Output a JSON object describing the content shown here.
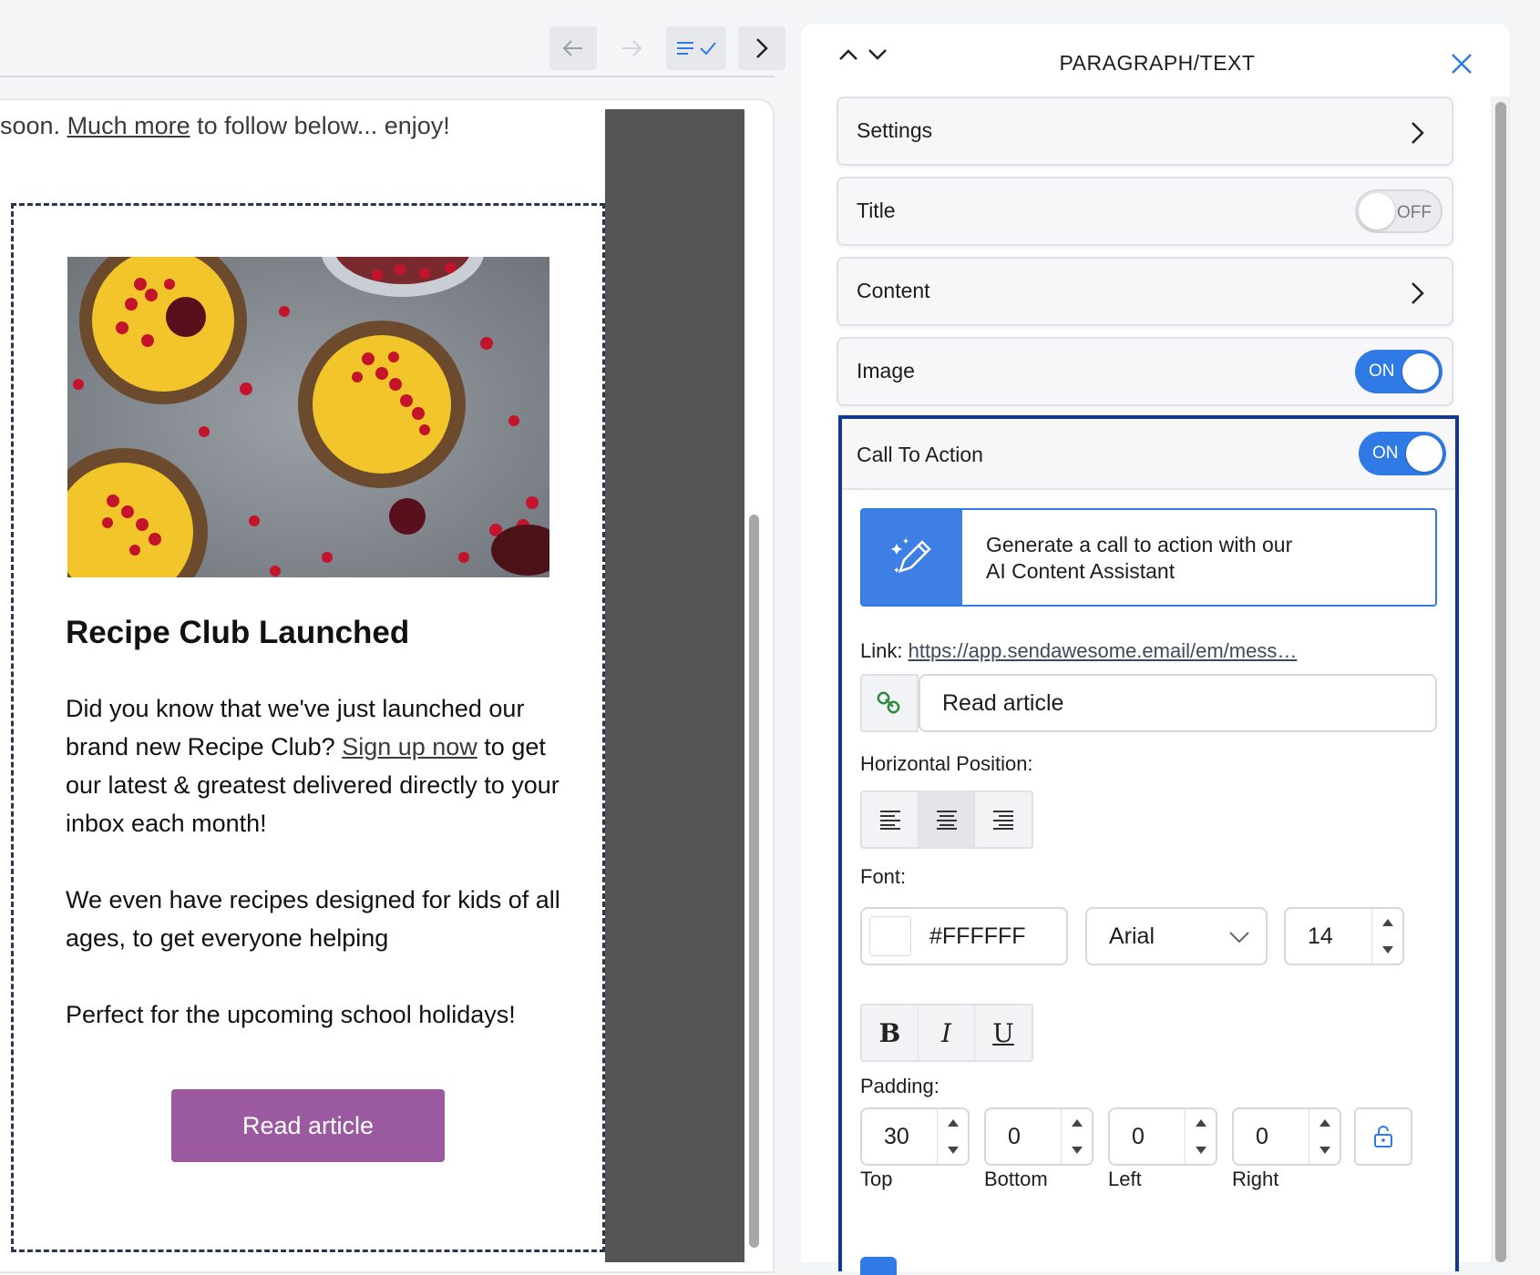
{
  "toolbar": {
    "back_icon": "arrow-left-icon",
    "forward_icon": "arrow-right-icon",
    "spellcheck_icon": "spellcheck-icon",
    "next_icon": "chevron-right-icon"
  },
  "email": {
    "intro_prefix": "soon. ",
    "intro_link": "Much more",
    "intro_suffix": " to follow below... enjoy!",
    "block_title": "Recipe Club Launched",
    "para1_before": "Did you know that we've just launched our brand new Recipe Club? ",
    "para1_link": "Sign up now",
    "para1_after": " to get our latest & greatest delivered directly to your inbox each month!",
    "para2": "We even have recipes designed for kids of all ages, to get everyone helping",
    "para3": "Perfect for the upcoming school holidays!",
    "button_label": "Read article",
    "button_color": "#9b59a0"
  },
  "panel": {
    "title": "PARAGRAPH/TEXT",
    "rows": {
      "settings": "Settings",
      "title": "Title",
      "title_toggle": "OFF",
      "content": "Content",
      "image": "Image",
      "image_toggle": "ON",
      "cta": "Call To Action",
      "cta_toggle": "ON"
    },
    "ai_line1": "Generate a call to action with our",
    "ai_line2": "AI Content Assistant",
    "link_label": "Link: ",
    "link_url": "https://app.sendawesome.email/em/mess…",
    "link_text": "Read article",
    "horizontal_position_label": "Horizontal Position:",
    "font_label": "Font:",
    "font_color": "#FFFFFF",
    "font_family": "Arial",
    "font_size": "14",
    "style_bold": "B",
    "style_italic": "I",
    "style_underline": "U",
    "padding_label": "Padding:",
    "padding": {
      "top": "30",
      "bottom": "0",
      "left": "0",
      "right": "0",
      "top_label": "Top",
      "bottom_label": "Bottom",
      "left_label": "Left",
      "right_label": "Right"
    },
    "accent_color": "#2f7ae5",
    "selection_color": "#0f3a8f"
  }
}
